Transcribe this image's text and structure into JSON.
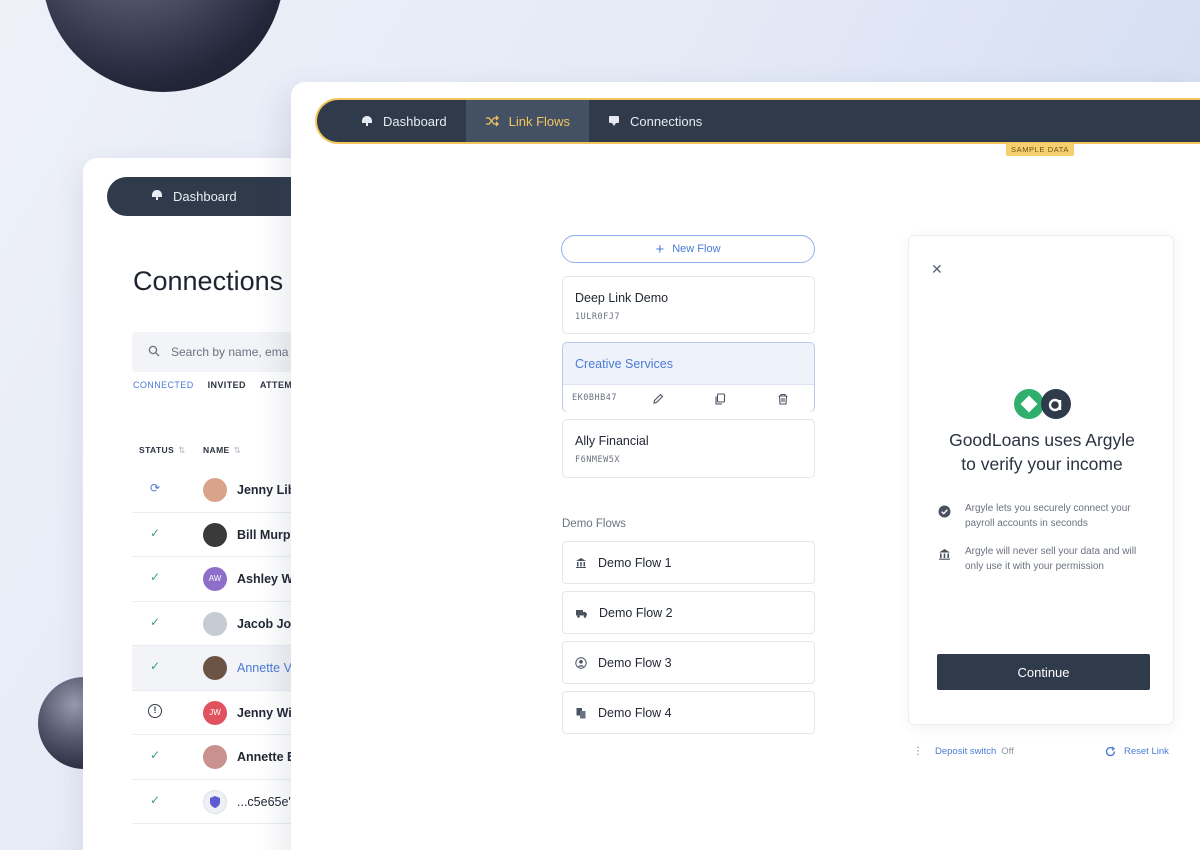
{
  "back_panel": {
    "nav": {
      "dashboard_label": "Dashboard"
    },
    "title": "Connections",
    "search": {
      "placeholder": "Search by name, ema"
    },
    "filter_tabs": [
      "CONNECTED",
      "INVITED",
      "ATTEM"
    ],
    "columns": {
      "status": "STATUS",
      "name": "NAME"
    },
    "rows": [
      {
        "status": "syncing",
        "avatar": "photo",
        "name": "Jenny Lib"
      },
      {
        "status": "connected",
        "avatar": "photo",
        "name": "Bill Murpl"
      },
      {
        "status": "connected",
        "avatar": "initials",
        "initials": "AW",
        "name": "Ashley W"
      },
      {
        "status": "connected",
        "avatar": "photo",
        "name": "Jacob Jor"
      },
      {
        "status": "connected",
        "avatar": "photo",
        "name": "Annette V"
      },
      {
        "status": "error",
        "avatar": "initials",
        "initials": "JW",
        "name": "Jenny Wi"
      },
      {
        "status": "connected",
        "avatar": "photo",
        "name": "Annette E"
      },
      {
        "status": "connected",
        "avatar": "shield",
        "name": "...c5e65e'"
      }
    ]
  },
  "nav": {
    "items": [
      {
        "label": "Dashboard",
        "icon": "dashboard-icon"
      },
      {
        "label": "Link Flows",
        "icon": "shuffle-icon",
        "active": true
      },
      {
        "label": "Connections",
        "icon": "connections-icon"
      }
    ],
    "badge": "SAMPLE DATA"
  },
  "flows": {
    "new_flow_label": "New Flow",
    "items": [
      {
        "name": "Deep Link Demo",
        "code": "1ULR0FJ7"
      },
      {
        "name": "Creative Services",
        "code": "EK0BHB47",
        "selected": true
      },
      {
        "name": "Ally Financial",
        "code": "F6NMEW5X"
      }
    ],
    "demo_heading": "Demo Flows",
    "demo_items": [
      {
        "name": "Demo Flow 1",
        "icon": "bank-icon"
      },
      {
        "name": "Demo Flow 2",
        "icon": "truck-icon"
      },
      {
        "name": "Demo Flow 3",
        "icon": "person-icon"
      },
      {
        "name": "Demo Flow 4",
        "icon": "copy-icon"
      }
    ]
  },
  "preview": {
    "title_line1": "GoodLoans uses Argyle",
    "title_line2": "to verify your income",
    "point1_line1": "Argyle lets you securely connect your",
    "point1_line2": "payroll accounts in seconds",
    "point2_line1": "Argyle will never sell your data and will",
    "point2_line2": "only use it with your permission",
    "continue_label": "Continue",
    "deposit_switch_label": "Deposit switch",
    "deposit_switch_state": "Off",
    "reset_link_label": "Reset Link"
  },
  "colors": {
    "accent_blue": "#4b7bd6",
    "nav_dark": "#2f3a4b",
    "highlight_yellow": "#f2c55c",
    "success_green": "#3ba372",
    "logo_green": "#2fae6c"
  }
}
